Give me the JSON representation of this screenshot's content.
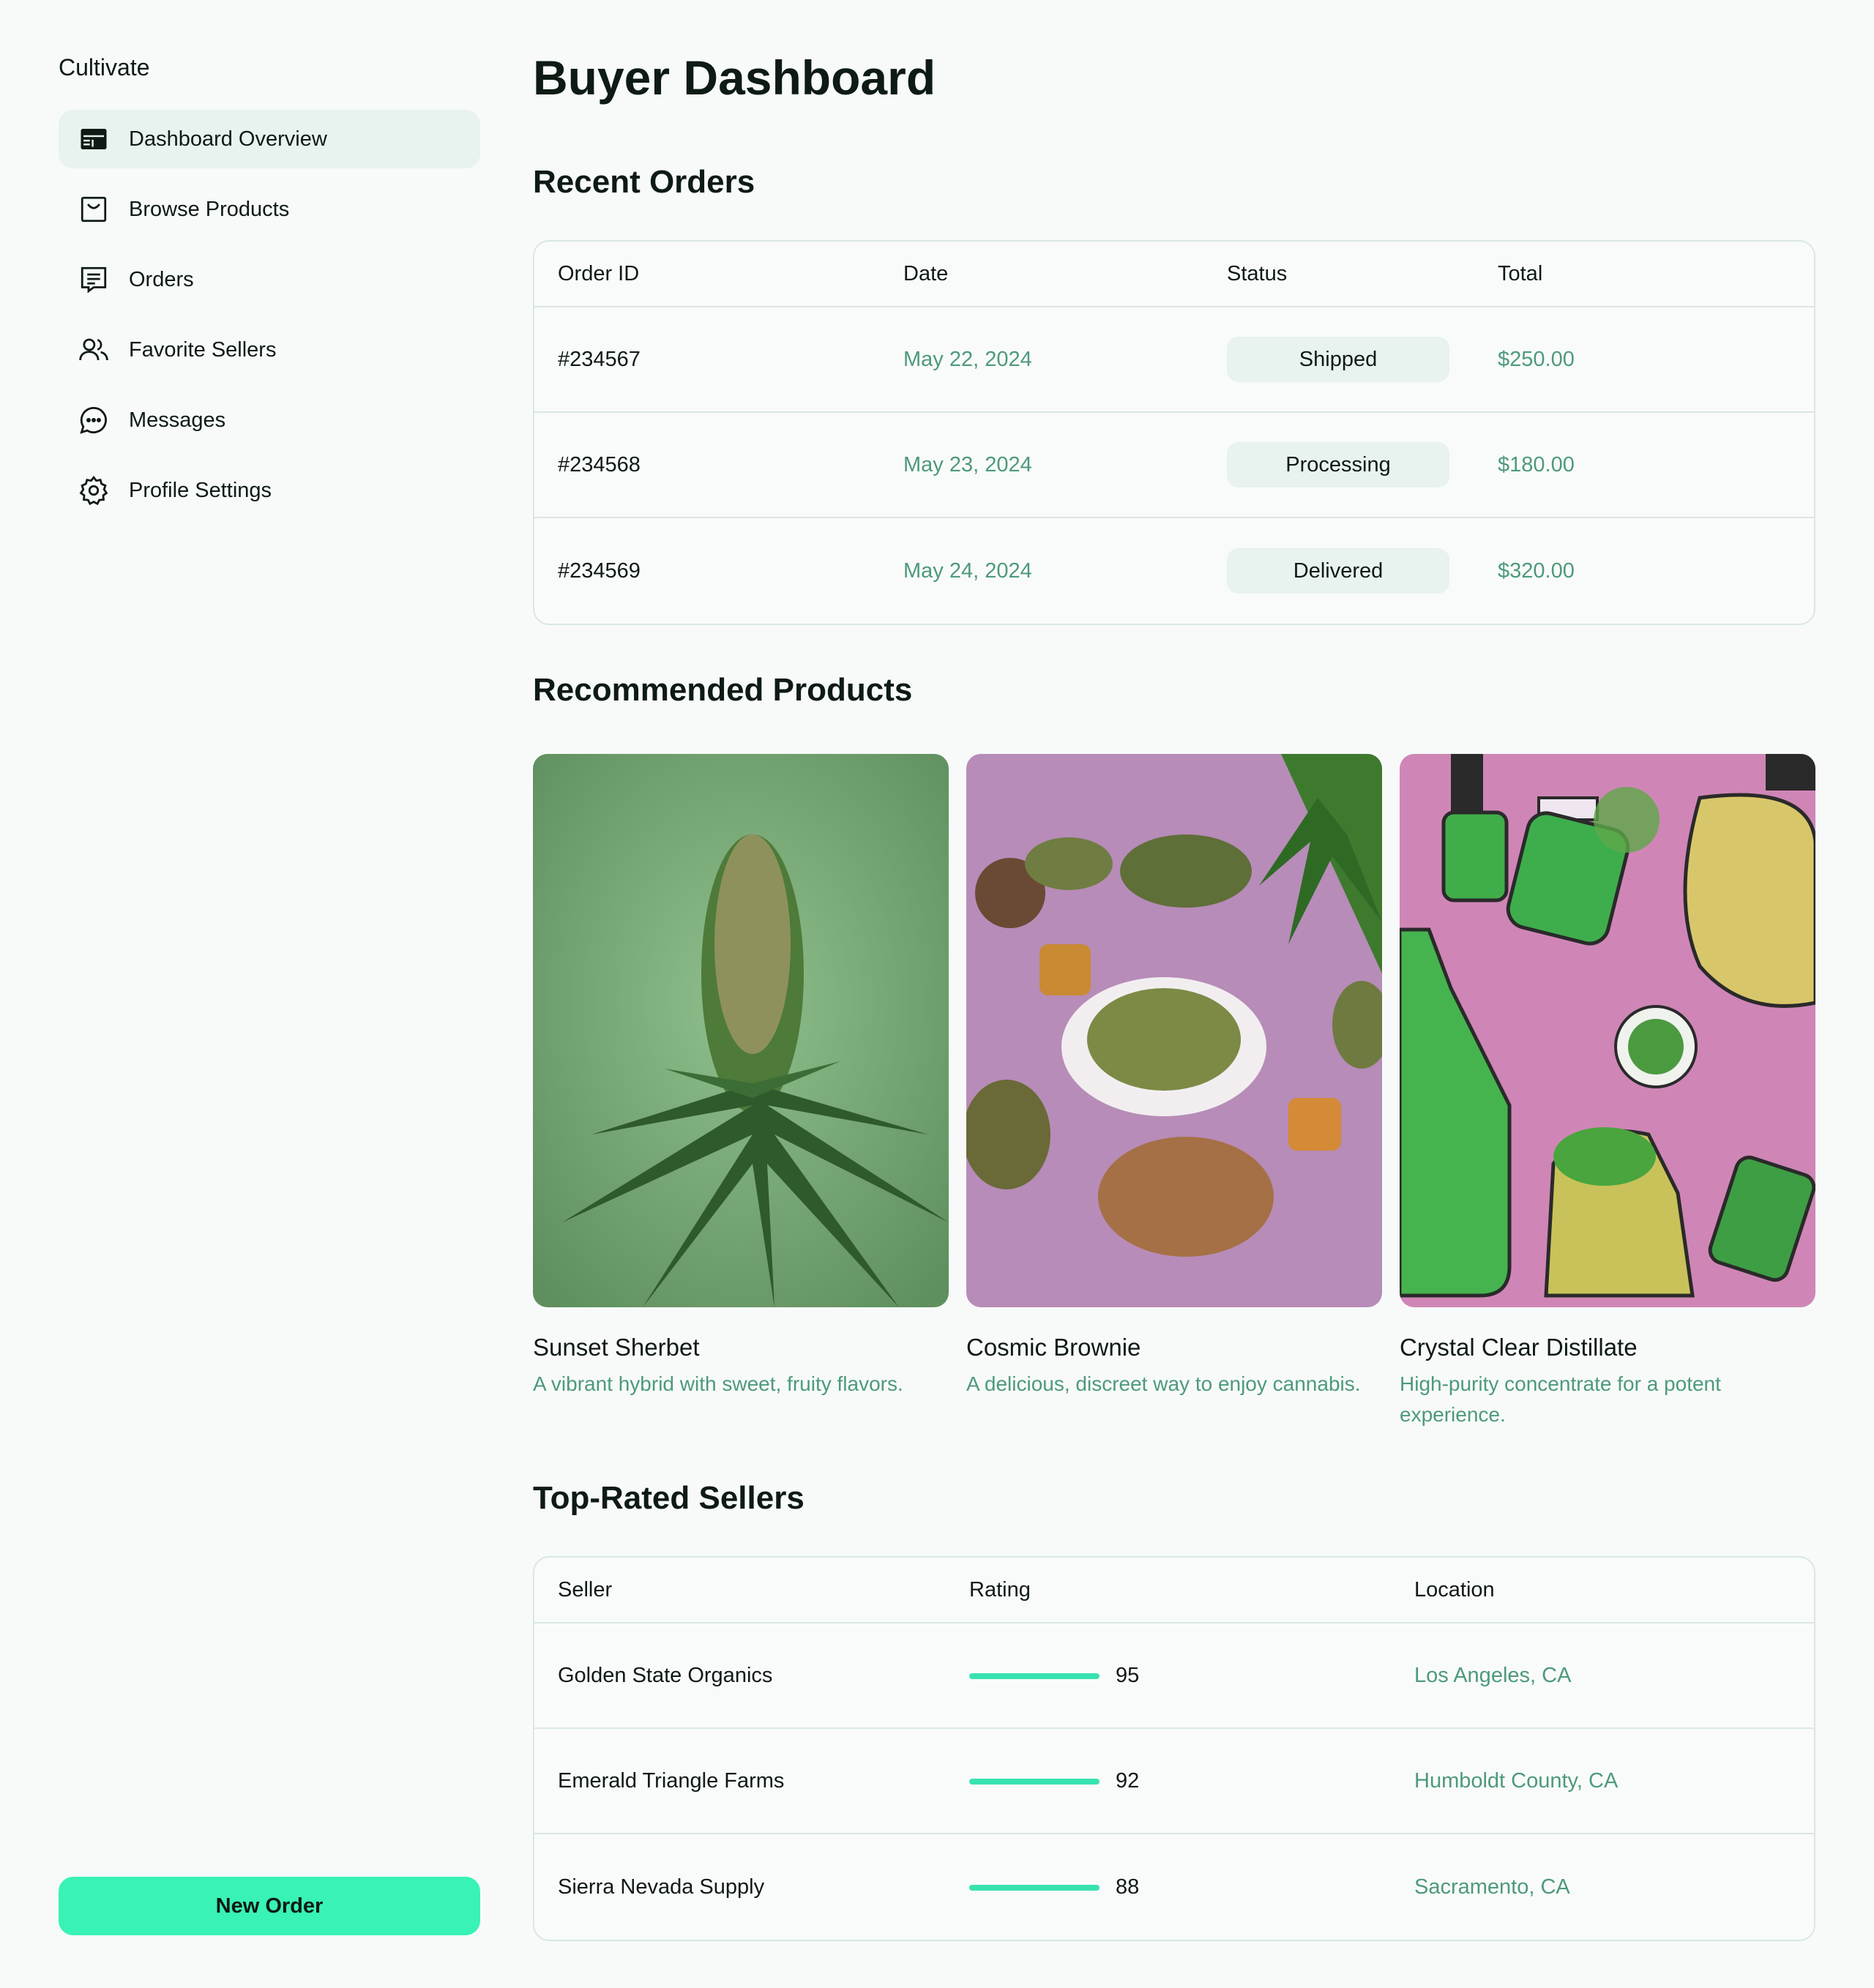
{
  "app": {
    "brand": "Cultivate"
  },
  "sidebar": {
    "items": [
      {
        "label": "Dashboard Overview",
        "icon": "dashboard-icon",
        "active": true
      },
      {
        "label": "Browse Products",
        "icon": "shopping-bag-icon",
        "active": false
      },
      {
        "label": "Orders",
        "icon": "orders-list-icon",
        "active": false
      },
      {
        "label": "Favorite Sellers",
        "icon": "users-icon",
        "active": false
      },
      {
        "label": "Messages",
        "icon": "chat-bubble-icon",
        "active": false
      },
      {
        "label": "Profile Settings",
        "icon": "gear-icon",
        "active": false
      }
    ],
    "new_order_label": "New Order"
  },
  "main": {
    "title": "Buyer Dashboard",
    "recent_orders": {
      "title": "Recent Orders",
      "columns": [
        "Order ID",
        "Date",
        "Status",
        "Total"
      ],
      "rows": [
        {
          "id": "#234567",
          "date": "May 22, 2024",
          "status": "Shipped",
          "total": "$250.00"
        },
        {
          "id": "#234568",
          "date": "May 23, 2024",
          "status": "Processing",
          "total": "$180.00"
        },
        {
          "id": "#234569",
          "date": "May 24, 2024",
          "status": "Delivered",
          "total": "$320.00"
        }
      ]
    },
    "recommended": {
      "title": "Recommended Products",
      "products": [
        {
          "name": "Sunset Sherbet",
          "description": "A vibrant hybrid with sweet, fruity flavors."
        },
        {
          "name": "Cosmic Brownie",
          "description": "A delicious, discreet way to enjoy cannabis."
        },
        {
          "name": "Crystal Clear Distillate",
          "description": "High-purity concentrate for a potent experience."
        }
      ]
    },
    "top_sellers": {
      "title": "Top-Rated Sellers",
      "columns": [
        "Seller",
        "Rating",
        "Location"
      ],
      "rows": [
        {
          "name": "Golden State Organics",
          "rating": "95",
          "location": "Los Angeles, CA"
        },
        {
          "name": "Emerald Triangle Farms",
          "rating": "92",
          "location": "Humboldt County, CA"
        },
        {
          "name": "Sierra Nevada Supply",
          "rating": "88",
          "location": "Sacramento, CA"
        }
      ]
    }
  },
  "colors": {
    "accent": "#38f2b6",
    "muted_text": "#4d9a7a",
    "active_nav_bg": "#e8f2ee",
    "page_bg": "#f7faf9"
  }
}
